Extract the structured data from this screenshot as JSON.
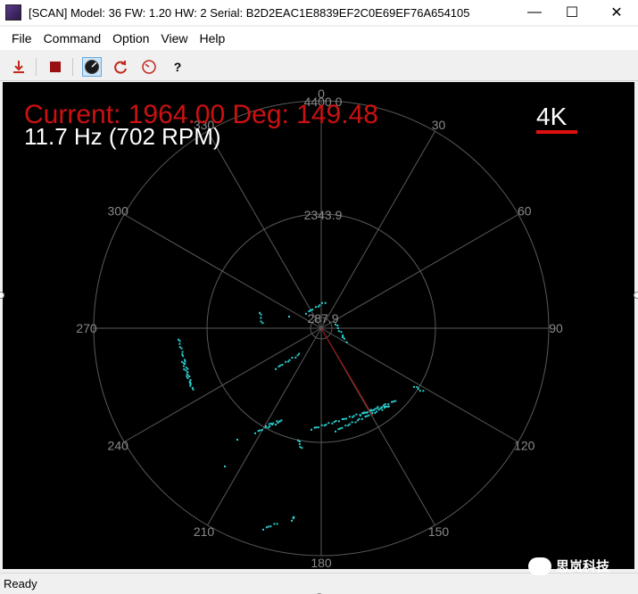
{
  "window": {
    "title": "[SCAN] Model: 36 FW: 1.20 HW: 2 Serial: B2D2EAC1E8839EF2C0E69EF76A654105",
    "minimize_glyph": "—",
    "maximize_glyph": "☐",
    "close_glyph": "✕"
  },
  "menu": {
    "items": [
      "File",
      "Command",
      "Option",
      "View",
      "Help"
    ]
  },
  "toolbar": {
    "icons": [
      "download-icon",
      "stop-icon",
      "scan-view-icon",
      "refresh-icon",
      "gauge-icon",
      "help-icon"
    ],
    "help_glyph": "?"
  },
  "radar": {
    "current_text": "Current: 1964.00 Deg: 149.48",
    "rate_text": "11.7 Hz (702 RPM)",
    "mode_badge": "4K",
    "ring_labels": [
      "4400.0",
      "2343.9",
      "287.9"
    ],
    "ring_values": [
      4400.0,
      2343.9,
      287.9
    ],
    "angle_labels": [
      "0",
      "30",
      "60",
      "90",
      "120",
      "150",
      "180",
      "210",
      "240",
      "270",
      "300",
      "330"
    ],
    "current_angle_deg": 149.48,
    "current_distance": 1964.0,
    "colors": {
      "background": "#000000",
      "grid": "#5a5a5a",
      "label": "#8a8a8a",
      "current_text": "#cc1111",
      "rate_text": "#ffffff",
      "badge_underline": "#e01010",
      "points": "#2ad0d0",
      "sweep_line": "#b01010"
    }
  },
  "status": {
    "text": "Ready"
  },
  "watermark": {
    "text": "思岚科技"
  }
}
